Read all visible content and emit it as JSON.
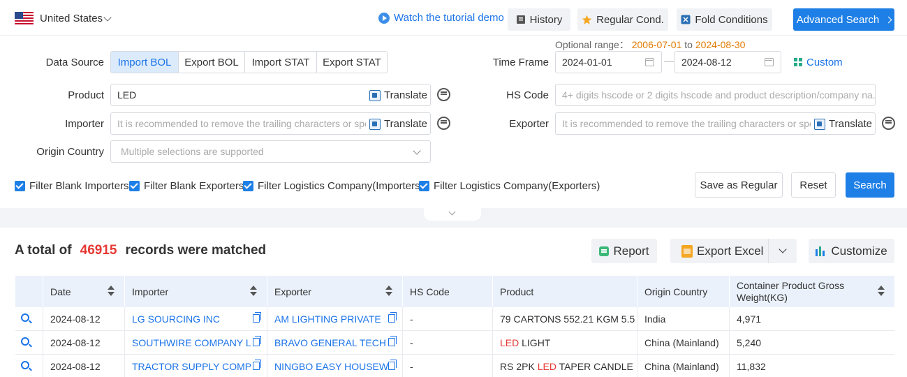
{
  "topbar": {
    "country": "United States",
    "tutorial_label": "Watch the tutorial demo",
    "history_label": "History",
    "regular_label": "Regular Cond.",
    "fold_label": "Fold Conditions",
    "advanced_label": "Advanced Search"
  },
  "form": {
    "data_source_label": "Data Source",
    "data_source_options": [
      "Import BOL",
      "Export BOL",
      "Import STAT",
      "Export STAT"
    ],
    "data_source_selected": "Import BOL",
    "optional_prefix": "Optional range：",
    "optional_start": "2006-07-01",
    "optional_to": "to",
    "optional_end": "2024-08-30",
    "time_frame_label": "Time Frame",
    "time_start": "2024-01-01",
    "time_end": "2024-08-12",
    "time_sep": "—",
    "custom_label": "Custom",
    "product_label": "Product",
    "product_value": "LED",
    "translate_label": "Translate",
    "hs_code_label": "HS Code",
    "hs_code_placeholder": "4+ digits hscode or 2 digits hscode and product description/company na...",
    "importer_label": "Importer",
    "importer_placeholder": "It is recommended to remove the trailing characters or spe",
    "exporter_label": "Exporter",
    "exporter_placeholder": "It is recommended to remove the trailing characters or spe",
    "origin_label": "Origin Country",
    "origin_placeholder": "Multiple selections are supported",
    "filters": [
      "Filter Blank Importers",
      "Filter Blank Exporters",
      "Filter Logistics Company(Importers)",
      "Filter Logistics Company(Exporters)"
    ],
    "save_regular_label": "Save as Regular",
    "reset_label": "Reset",
    "search_label": "Search"
  },
  "results": {
    "prefix": "A total of",
    "count": "46915",
    "suffix": "records were matched",
    "report_label": "Report",
    "export_label": "Export Excel",
    "customize_label": "Customize"
  },
  "table": {
    "headers": [
      "Date",
      "Importer",
      "Exporter",
      "HS Code",
      "Product",
      "Origin Country",
      "Container Product Gross Weight(KG)"
    ],
    "rows": [
      {
        "date": "2024-08-12",
        "importer": "LG SOURCING INC",
        "exporter": "AM LIGHTING PRIVATE",
        "hs": "-",
        "product_pre": "79 CARTONS 552.21 KGM 5.5",
        "product_hl": "",
        "product_post": "",
        "origin": "India",
        "weight": "4,971"
      },
      {
        "date": "2024-08-12",
        "importer": "SOUTHWIRE COMPANY L",
        "exporter": "BRAVO GENERAL TECH",
        "hs": "-",
        "product_pre": "",
        "product_hl": "LED",
        "product_post": " LIGHT",
        "origin": "China (Mainland)",
        "weight": "5,240"
      },
      {
        "date": "2024-08-12",
        "importer": "TRACTOR SUPPLY COMP",
        "exporter": "NINGBO EASY HOUSEW",
        "hs": "-",
        "product_pre": "RS 2PK ",
        "product_hl": "LED",
        "product_post": " TAPER CANDLE",
        "origin": "China (Mainland)",
        "weight": "11,832"
      }
    ]
  },
  "colors": {
    "accent": "#1e7fe6",
    "highlight": "#e53935",
    "range": "#e07b00"
  }
}
